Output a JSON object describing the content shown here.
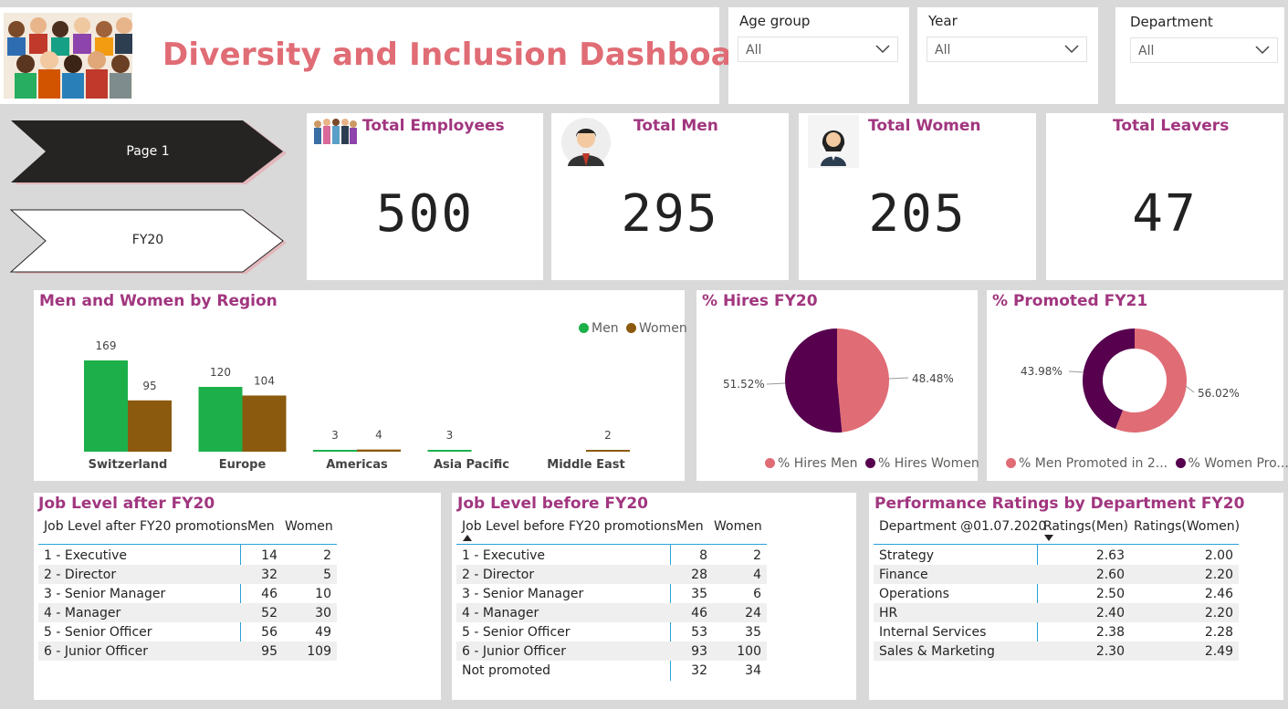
{
  "header": {
    "title": "Diversity and Inclusion Dashboard",
    "logo_icon": "people-crowd-icon"
  },
  "slicers": [
    {
      "label": "Age group",
      "value": "All"
    },
    {
      "label": "Year",
      "value": "All"
    },
    {
      "label": "Department",
      "value": "All"
    }
  ],
  "nav": {
    "page1_label": "Page 1",
    "fy20_label": "FY20"
  },
  "kpis": [
    {
      "title": "Total Employees",
      "value": "500",
      "icon": "group-people-icon"
    },
    {
      "title": "Total Men",
      "value": "295",
      "icon": "man-avatar-icon"
    },
    {
      "title": "Total Women",
      "value": "205",
      "icon": "woman-avatar-icon"
    },
    {
      "title": "Total Leavers",
      "value": "47"
    }
  ],
  "colors": {
    "men": "#1db04a",
    "women": "#8b5a0e",
    "pink": "#e06c75",
    "purple": "#56004e",
    "title": "#a1367f"
  },
  "region_chart": {
    "title": "Men and Women by Region",
    "legend": {
      "men": "Men",
      "women": "Women"
    },
    "chart_data": {
      "type": "bar",
      "categories": [
        "Switzerland",
        "Europe",
        "Americas",
        "Asia Pacific",
        "Middle East"
      ],
      "series": [
        {
          "name": "Men",
          "values": [
            169,
            120,
            3,
            3,
            null
          ]
        },
        {
          "name": "Women",
          "values": [
            95,
            104,
            4,
            null,
            2
          ]
        }
      ],
      "labels": {
        "men": [
          "169",
          "120",
          "3",
          "3",
          ""
        ],
        "women": [
          "95",
          "104",
          "4",
          "",
          "2"
        ]
      }
    }
  },
  "hires_chart": {
    "title": "% Hires FY20",
    "chart_data": {
      "type": "pie",
      "labels": [
        "% Hires Men",
        "% Hires Women"
      ],
      "values": [
        48.48,
        51.52
      ]
    },
    "label_men": "48.48%",
    "label_women": "51.52%",
    "legend_men": "% Hires Men",
    "legend_women": "% Hires Women"
  },
  "promoted_chart": {
    "title": "% Promoted FY21",
    "chart_data": {
      "type": "pie",
      "labels": [
        "% Men Promoted in 2...",
        "% Women Pro..."
      ],
      "values": [
        56.02,
        43.98
      ]
    },
    "label_men": "56.02%",
    "label_women": "43.98%",
    "legend_men": "% Men Promoted in 2...",
    "legend_women": "% Women Pro..."
  },
  "job_after": {
    "title": "Job Level after FY20",
    "headers": [
      "Job Level after FY20 promotions",
      "Men",
      "Women"
    ],
    "rows": [
      [
        "1 - Executive",
        "14",
        "2"
      ],
      [
        "2 - Director",
        "32",
        "5"
      ],
      [
        "3 - Senior Manager",
        "46",
        "10"
      ],
      [
        "4 - Manager",
        "52",
        "30"
      ],
      [
        "5 - Senior Officer",
        "56",
        "49"
      ],
      [
        "6 - Junior Officer",
        "95",
        "109"
      ]
    ]
  },
  "job_before": {
    "title": "Job Level before FY20",
    "headers": [
      "Job Level before FY20 promotions",
      "Men",
      "Women"
    ],
    "rows": [
      [
        "1 - Executive",
        "8",
        "2"
      ],
      [
        "2 - Director",
        "28",
        "4"
      ],
      [
        "3 - Senior Manager",
        "35",
        "6"
      ],
      [
        "4 - Manager",
        "46",
        "24"
      ],
      [
        "5 - Senior Officer",
        "53",
        "35"
      ],
      [
        "6 - Junior Officer",
        "93",
        "100"
      ],
      [
        "Not promoted",
        "32",
        "34"
      ]
    ]
  },
  "perf": {
    "title": "Performance Ratings by Department FY20",
    "headers": [
      "Department @01.07.2020",
      "Ratings(Men)",
      "Ratings(Women)"
    ],
    "rows": [
      [
        "Strategy",
        "2.63",
        "2.00"
      ],
      [
        "Finance",
        "2.60",
        "2.20"
      ],
      [
        "Operations",
        "2.50",
        "2.46"
      ],
      [
        "HR",
        "2.40",
        "2.20"
      ],
      [
        "Internal Services",
        "2.38",
        "2.28"
      ],
      [
        "Sales & Marketing",
        "2.30",
        "2.49"
      ]
    ]
  }
}
